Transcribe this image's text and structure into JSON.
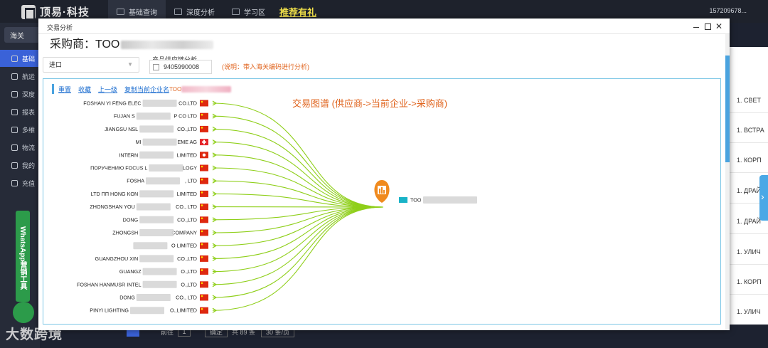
{
  "topbar": {
    "brand": "顶易·科技",
    "nav": [
      {
        "label": "基础查询",
        "active": true
      },
      {
        "label": "深度分析",
        "active": false
      },
      {
        "label": "学习区",
        "active": false
      }
    ],
    "promo": "推荐有礼",
    "user": "157209678..."
  },
  "sidebar": {
    "head": "海关",
    "items": [
      {
        "label": "基础",
        "active": true
      },
      {
        "label": "航运",
        "active": false
      },
      {
        "label": "深度",
        "active": false
      },
      {
        "label": "报表",
        "active": false
      },
      {
        "label": "多维",
        "active": false
      },
      {
        "label": "物流",
        "active": false
      },
      {
        "label": "我的",
        "active": false
      },
      {
        "label": "充值",
        "active": false
      }
    ],
    "whatsapp": "WhatsApp营销工具",
    "watermark": "大数跨境"
  },
  "background_list": {
    "rows": [
      "1. СВЕТ",
      "1. ВСТРА",
      "1. КОРП",
      "1. ДРАЙ",
      "1. ДРАЙ",
      "1. УЛИЧ",
      "1. КОРП",
      "1. УЛИЧ"
    ],
    "pager": {
      "total": "共 89 条",
      "go": "前往",
      "page": "1",
      "confirm": "确定",
      "page_size": "30 条/页"
    }
  },
  "modal": {
    "title": "交易分析",
    "buyer_prefix": "采购商：TOO",
    "trade_direction": "进口",
    "supply_chain_label": "产品供应链分析",
    "hs_code": "9405990008",
    "note": "(说明：带入海关编码进行分析)",
    "toolbar": [
      "重置",
      "收藏",
      "上一级",
      "复制当前企业名"
    ],
    "toolbar_tail": "TOO",
    "graph_title": "交易图谱 (供应商->当前企业->采购商)",
    "center_label": "TOO",
    "center_flag": "#19b3c7",
    "suppliers": [
      {
        "left": "FOSHAN YI FENG ELEC",
        "right": "CO.LTD",
        "flag": "cn"
      },
      {
        "left": "FUJAN S",
        "right": "P CO LTD",
        "flag": "cn"
      },
      {
        "left": "JIANGSU NSL",
        "right": "CO.,LTD",
        "flag": "cn"
      },
      {
        "left": "MI",
        "right": "EME AG",
        "flag": "ch"
      },
      {
        "left": "INTERN",
        "right": "LIMITED",
        "flag": "hk"
      },
      {
        "left": "ПОРУЧЕНИЮ FOCUS L",
        "right": "LOGY",
        "flag": "cn"
      },
      {
        "left": "FOSHA",
        "right": ", LTD",
        "flag": "cn"
      },
      {
        "left": "LTD ПП HONG KON",
        "right": "LIMITED",
        "flag": "cn"
      },
      {
        "left": "ZHONGSHAN YOU",
        "right": "CO., LTD",
        "flag": "cn"
      },
      {
        "left": "DONG",
        "right": "CO.,LTD",
        "flag": "cn"
      },
      {
        "left": "ZHONGSH",
        "right": "COMPANY",
        "flag": "cn"
      },
      {
        "left": "",
        "right": "O LIMITED",
        "flag": "cn"
      },
      {
        "left": "GUANGZHOU XIN",
        "right": "CO.,LTD",
        "flag": "cn"
      },
      {
        "left": "GUANGZ",
        "right": "O.,LTD",
        "flag": "cn"
      },
      {
        "left": "FOSHAN HANMUSR INTEL",
        "right": "O.,LTD",
        "flag": "cn"
      },
      {
        "left": "DONG",
        "right": "CO., LTD",
        "flag": "cn"
      },
      {
        "left": "PINYI LIGHTING",
        "right": "O.,LIMITED",
        "flag": "cn"
      }
    ]
  },
  "colors": {
    "edge": "#8fcf1a",
    "marker": "#f08a1e",
    "note": "#e0641e",
    "link": "#1f6fd0"
  }
}
